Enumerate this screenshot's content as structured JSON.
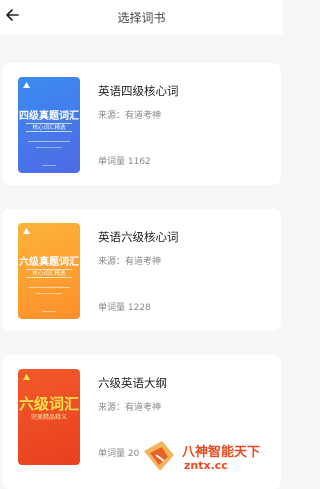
{
  "header": {
    "title": "选择词书"
  },
  "books": [
    {
      "name": "英语四级核心词",
      "source": "来源：有道考神",
      "count": "单词量  1162",
      "cover_title": "四级真题词汇",
      "cover_subtitle": "核心词汇精选",
      "cover_color": "#3b8cf0"
    },
    {
      "name": "英语六级核心词",
      "source": "来源：有道考神",
      "count": "单词量  1228",
      "cover_title": "六级真题词汇",
      "cover_subtitle": "核心词汇精选",
      "cover_color": "#fda535"
    },
    {
      "name": "六级英语大纲",
      "source": "来源：有道考神",
      "count": "单词量  20",
      "cover_title": "六级词汇",
      "cover_subtitle": "完美精品释义",
      "cover_color": "#f04e25"
    }
  ],
  "watermark": {
    "line1": "八神智能天下",
    "line2": "zntx.cc"
  }
}
